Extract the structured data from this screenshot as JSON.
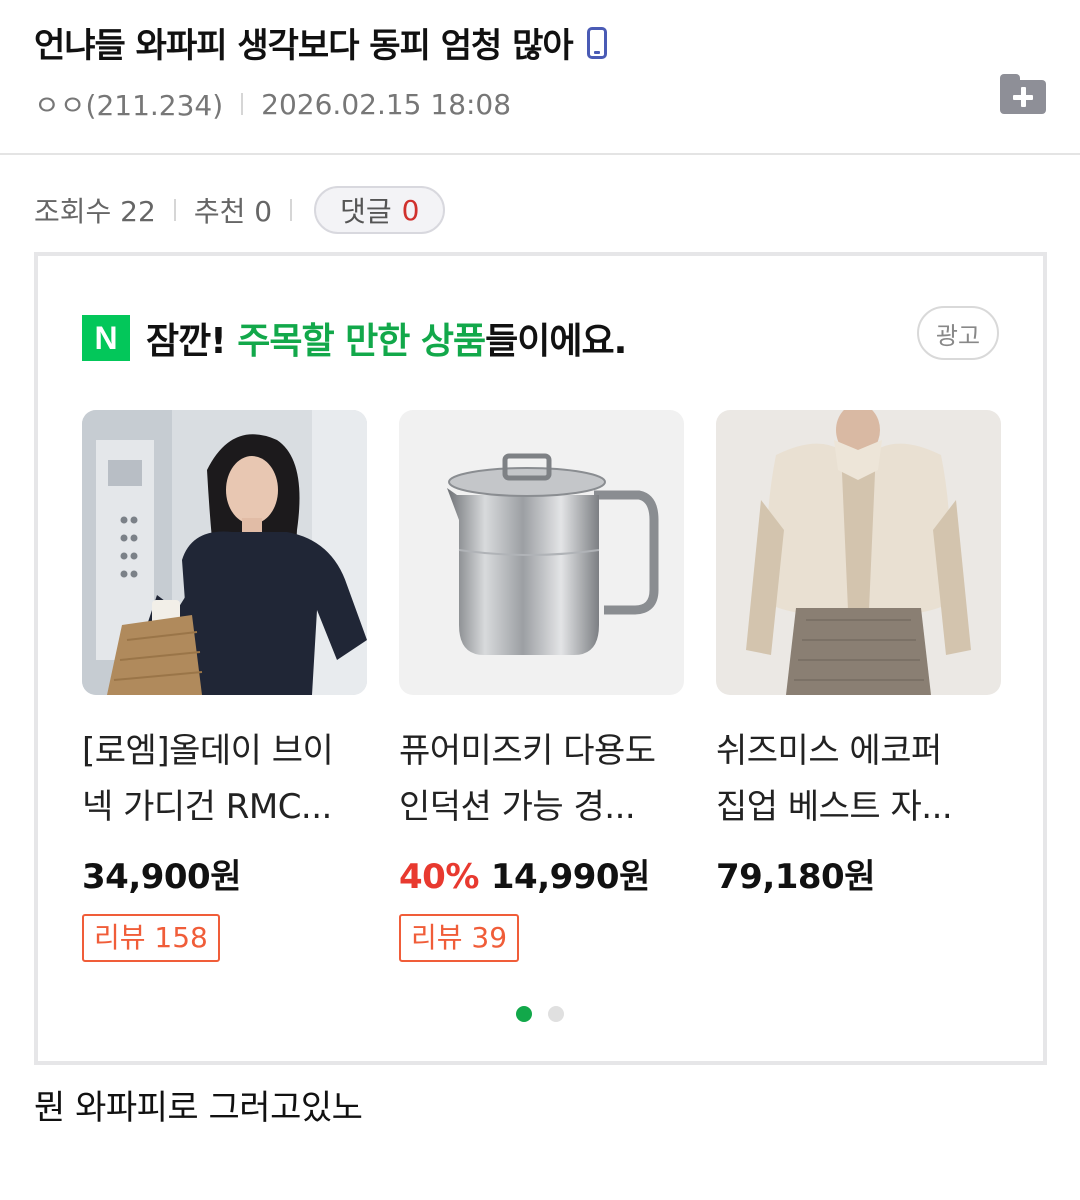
{
  "post": {
    "title": "언냐들 와파피 생각보다 동피 엄청 많아",
    "author": "ㅇㅇ(211.234)",
    "datetime": "2026.02.15 18:08",
    "device_icon": "mobile-icon",
    "scrap_icon": "folder-plus-icon"
  },
  "stats": {
    "views": "조회수 22",
    "recommend": "추천 0",
    "comment_label": "댓글",
    "comment_count": "0"
  },
  "ad": {
    "logo": "N",
    "headline_prefix": "잠깐! ",
    "headline_highlight": "주목할 만한 상품",
    "headline_suffix": "들이에요.",
    "badge": "광고",
    "products": [
      {
        "name_line1": "[로엠]올데이 브이",
        "name_line2": "넥 가디건 RMC...",
        "discount": "",
        "price": "34,900원",
        "review": "리뷰 158"
      },
      {
        "name_line1": "퓨어미즈키 다용도",
        "name_line2": "인덕션 가능 경...",
        "discount": "40%",
        "price": "14,990원",
        "review": "리뷰 39"
      },
      {
        "name_line1": "쉬즈미스 에코퍼",
        "name_line2": "집업 베스트 자...",
        "discount": "",
        "price": "79,180원",
        "review": ""
      }
    ],
    "pagination": {
      "current": 1,
      "total": 2
    }
  },
  "body_text": "뭔 와파피로 그러고있노",
  "colors": {
    "naver_green": "#03c75a",
    "highlight_green": "#12a84a",
    "discount_red": "#e8392f",
    "review_orange": "#f05d39",
    "comment_red": "#d0312d"
  }
}
